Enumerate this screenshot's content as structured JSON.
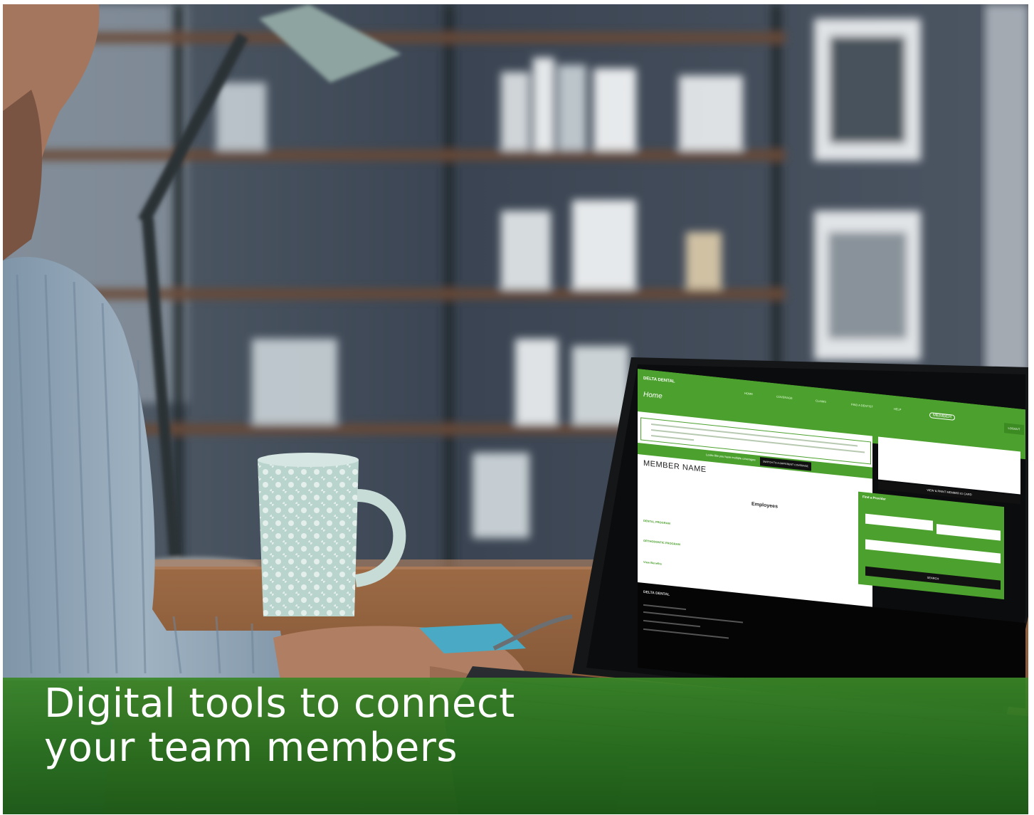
{
  "caption": {
    "line1": "Digital tools to connect",
    "line2": "your team members"
  },
  "screen": {
    "logo": "DELTA DENTAL",
    "page_title": "Home",
    "nav": [
      "HOME",
      "COVERAGE",
      "CLAIMS",
      "FIND A DENTIST",
      "HELP"
    ],
    "account_badge": "MEMBER",
    "logout_label": "LOGOUT",
    "banner_text": "Looks like you have multiple coverages",
    "banner_button": "SWITCH TO A DIFFERENT COVERAGE",
    "member_name": "MEMBER NAME",
    "employees_heading": "Employees",
    "dental_program": "DENTAL PROGRAM",
    "orthodontic_program": "ORTHODONTIC PROGRAM",
    "view_benefits": "View Benefits",
    "side_button": "VIEW & PRINT MEMBER ID CARD",
    "finder_title": "Find a Provider",
    "search_button": "SEARCH",
    "footer_logo": "DELTA DENTAL"
  },
  "colors": {
    "brand_green": "#4ca12e",
    "caption_band": "#2f7a22",
    "footer_black": "#050505"
  }
}
